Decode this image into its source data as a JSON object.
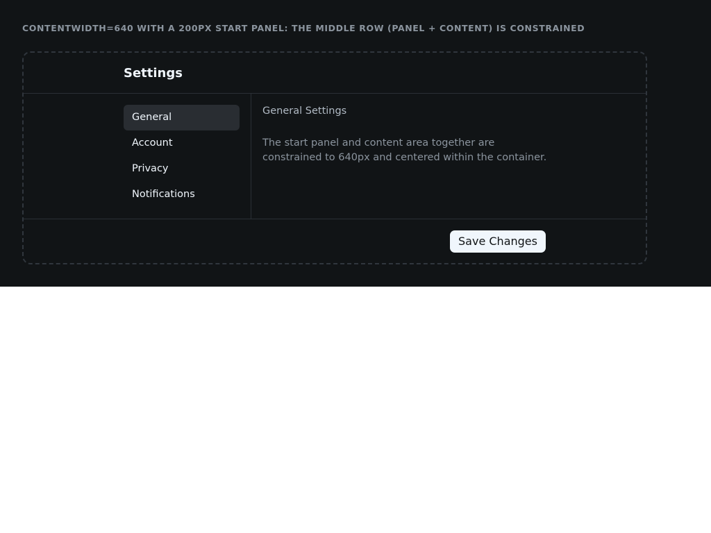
{
  "caption": "CONTENTWIDTH=640 WITH A 200PX START PANEL: THE MIDDLE ROW (PANEL + CONTENT) IS CONSTRAINED",
  "header": {
    "title": "Settings"
  },
  "sidebar": {
    "items": [
      {
        "label": "General",
        "active": true
      },
      {
        "label": "Account",
        "active": false
      },
      {
        "label": "Privacy",
        "active": false
      },
      {
        "label": "Notifications",
        "active": false
      }
    ]
  },
  "content": {
    "section_title": "General Settings",
    "description": "The start panel and content area together are constrained to 640px and centered within the container."
  },
  "footer": {
    "save_label": "Save Changes"
  },
  "colors": {
    "background": "#111416",
    "border": "#30363d",
    "active_item": "#292d32",
    "text_primary": "#f0f6fc",
    "text_secondary": "#8b949e",
    "button_bg": "#f0f6fc"
  }
}
